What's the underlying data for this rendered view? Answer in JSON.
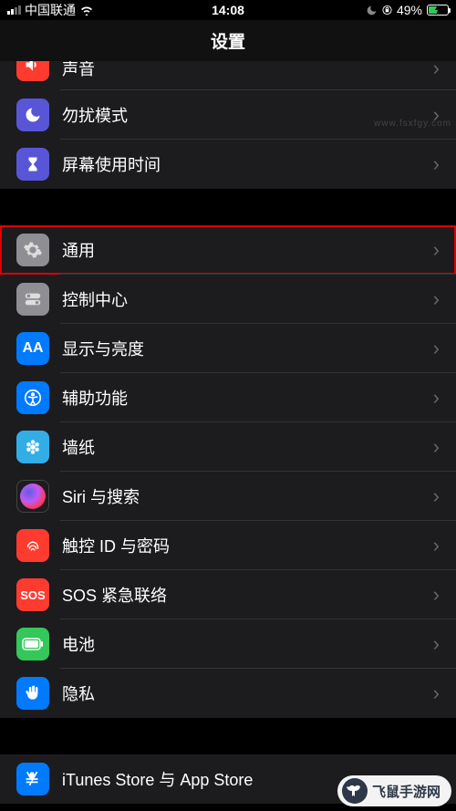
{
  "status": {
    "carrier": "中国联通",
    "time": "14:08",
    "battery": "49%"
  },
  "header": {
    "title": "设置"
  },
  "groups": [
    {
      "rows": [
        {
          "label": "声音",
          "icon": "sound-icon",
          "bg": "bg-red",
          "cut": true
        },
        {
          "label": "勿扰模式",
          "icon": "moon-icon",
          "bg": "bg-purple"
        },
        {
          "label": "屏幕使用时间",
          "icon": "hourglass-icon",
          "bg": "bg-purple"
        }
      ]
    },
    {
      "rows": [
        {
          "label": "通用",
          "icon": "gear-icon",
          "bg": "bg-gray",
          "highlighted": true
        },
        {
          "label": "控制中心",
          "icon": "switches-icon",
          "bg": "bg-gray"
        },
        {
          "label": "显示与亮度",
          "icon": "text-icon",
          "bg": "bg-blue"
        },
        {
          "label": "辅助功能",
          "icon": "accessibility-icon",
          "bg": "bg-blue"
        },
        {
          "label": "墙纸",
          "icon": "flower-icon",
          "bg": "bg-cyan"
        },
        {
          "label": "Siri 与搜索",
          "icon": "siri-icon",
          "bg": "bg-gradient"
        },
        {
          "label": "触控 ID 与密码",
          "icon": "fingerprint-icon",
          "bg": "bg-orange"
        },
        {
          "label": "SOS 紧急联络",
          "icon": "sos-icon",
          "bg": "bg-orange"
        },
        {
          "label": "电池",
          "icon": "battery-icon",
          "bg": "bg-green"
        },
        {
          "label": "隐私",
          "icon": "hand-icon",
          "bg": "bg-blue"
        }
      ]
    },
    {
      "rows": [
        {
          "label": "iTunes Store 与 App Store",
          "icon": "appstore-icon",
          "bg": "bg-blue"
        }
      ]
    }
  ],
  "watermark": {
    "text": "飞鼠手游网",
    "url": "www.fsxfgy.com"
  }
}
